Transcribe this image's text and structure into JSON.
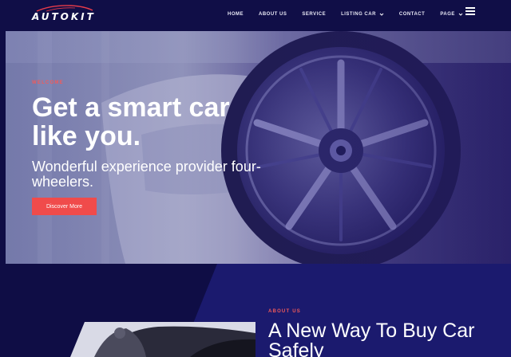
{
  "header": {
    "logo_text": "AUTOKIT",
    "nav": [
      "HOME",
      "ABOUT US",
      "SERVICE",
      "LISTING CAR",
      "CONTACT",
      "PAGE"
    ]
  },
  "hero": {
    "eyebrow": "WELCOME",
    "title": "Get a smart car like you.",
    "subtitle": "Wonderful experience provider four-wheelers.",
    "cta": "Discover More"
  },
  "about": {
    "eyebrow": "ABOUT US",
    "title": "A New Way To Buy Car Safely"
  },
  "colors": {
    "background": "#0f0d45",
    "accent": "#f04b4b",
    "panel": "#1b1a6e"
  },
  "icons": [
    "chevron-down-icon",
    "hamburger-menu-icon"
  ]
}
